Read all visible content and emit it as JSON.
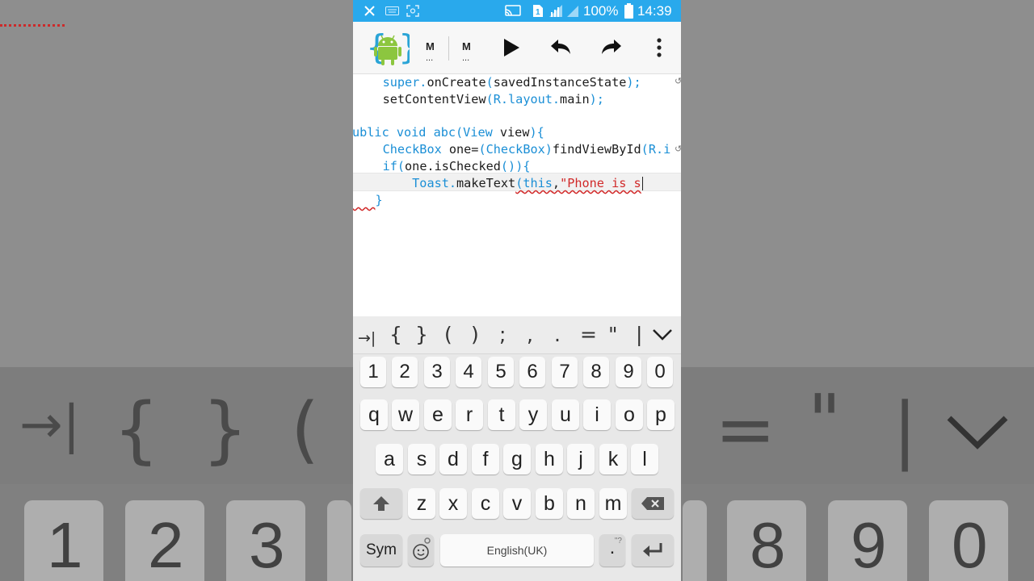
{
  "status_bar": {
    "battery_percent": "100%",
    "time": "14:39",
    "icons": [
      "close-icon",
      "keyboard-icon",
      "screenshot-icon",
      "cast-icon",
      "sim-icon",
      "signal-icon",
      "battery-icon"
    ]
  },
  "toolbar": {
    "tab1_label": "M",
    "tab1_dots": "...",
    "tab2_label": "M",
    "tab2_dots": "...",
    "actions": [
      "run-icon",
      "undo-icon",
      "redo-icon",
      "more-icon"
    ]
  },
  "editor": {
    "lines": [
      {
        "t1": "    ",
        "kw": "super",
        "p1": ".",
        "m": "onCreate",
        "p2": "(",
        "a": "savedInstanceState",
        "p3": ");"
      },
      {
        "t1": "    setContentView",
        "p1": "(",
        "r": "R.layout.",
        "m": "main",
        "p2": ");"
      }
    ],
    "line1": {
      "indent": "    ",
      "kw": "super",
      "dot": ".",
      "method": "onCreate",
      "open": "(",
      "arg": "savedInstanceState",
      "close": ");"
    },
    "line2": {
      "indent": "    ",
      "method": "setContentView",
      "open": "(",
      "r": "R.layout.",
      "main": "main",
      "close": ");"
    },
    "line4": {
      "prefix": "ublic void abc",
      "open": "(",
      "type": "View",
      "rest": " view",
      "close": "){"
    },
    "line5": {
      "indent": "    ",
      "type": "CheckBox",
      "a": " one=",
      "open": "(",
      "type2": "CheckBox",
      "close": ")",
      "call": "findViewById",
      "open2": "(",
      "rid": "R.i"
    },
    "line6": {
      "indent": "    ",
      "kw": "if",
      "open": "(",
      "a": "one.isChecked",
      "b": "()",
      "close": "){"
    },
    "line7": {
      "indent": "        ",
      "type": "Toast.",
      "method": "makeText",
      "open": "(",
      "arg1": "this",
      "comma": ",",
      "str": "\"Phone is s"
    },
    "line8": {
      "brace": "}"
    }
  },
  "keyboard": {
    "symbols": [
      "→|",
      "{",
      "}",
      "(",
      ")",
      ";",
      ",",
      ".",
      "=",
      "\"",
      "|"
    ],
    "numbers": [
      "1",
      "2",
      "3",
      "4",
      "5",
      "6",
      "7",
      "8",
      "9",
      "0"
    ],
    "row1": [
      "q",
      "w",
      "e",
      "r",
      "t",
      "y",
      "u",
      "i",
      "o",
      "p"
    ],
    "row2": [
      "a",
      "s",
      "d",
      "f",
      "g",
      "h",
      "j",
      "k",
      "l"
    ],
    "row3": [
      "z",
      "x",
      "c",
      "v",
      "b",
      "n",
      "m"
    ],
    "sym_label": "Sym",
    "space_label": "English(UK)",
    "period_label": ".",
    "period_hint": "\"?"
  },
  "background": {
    "chars": [
      "→|",
      "{",
      "}",
      "(",
      "=",
      "\"",
      "|"
    ],
    "numbers": [
      "1",
      "2",
      "3",
      "8",
      "9",
      "0"
    ]
  }
}
